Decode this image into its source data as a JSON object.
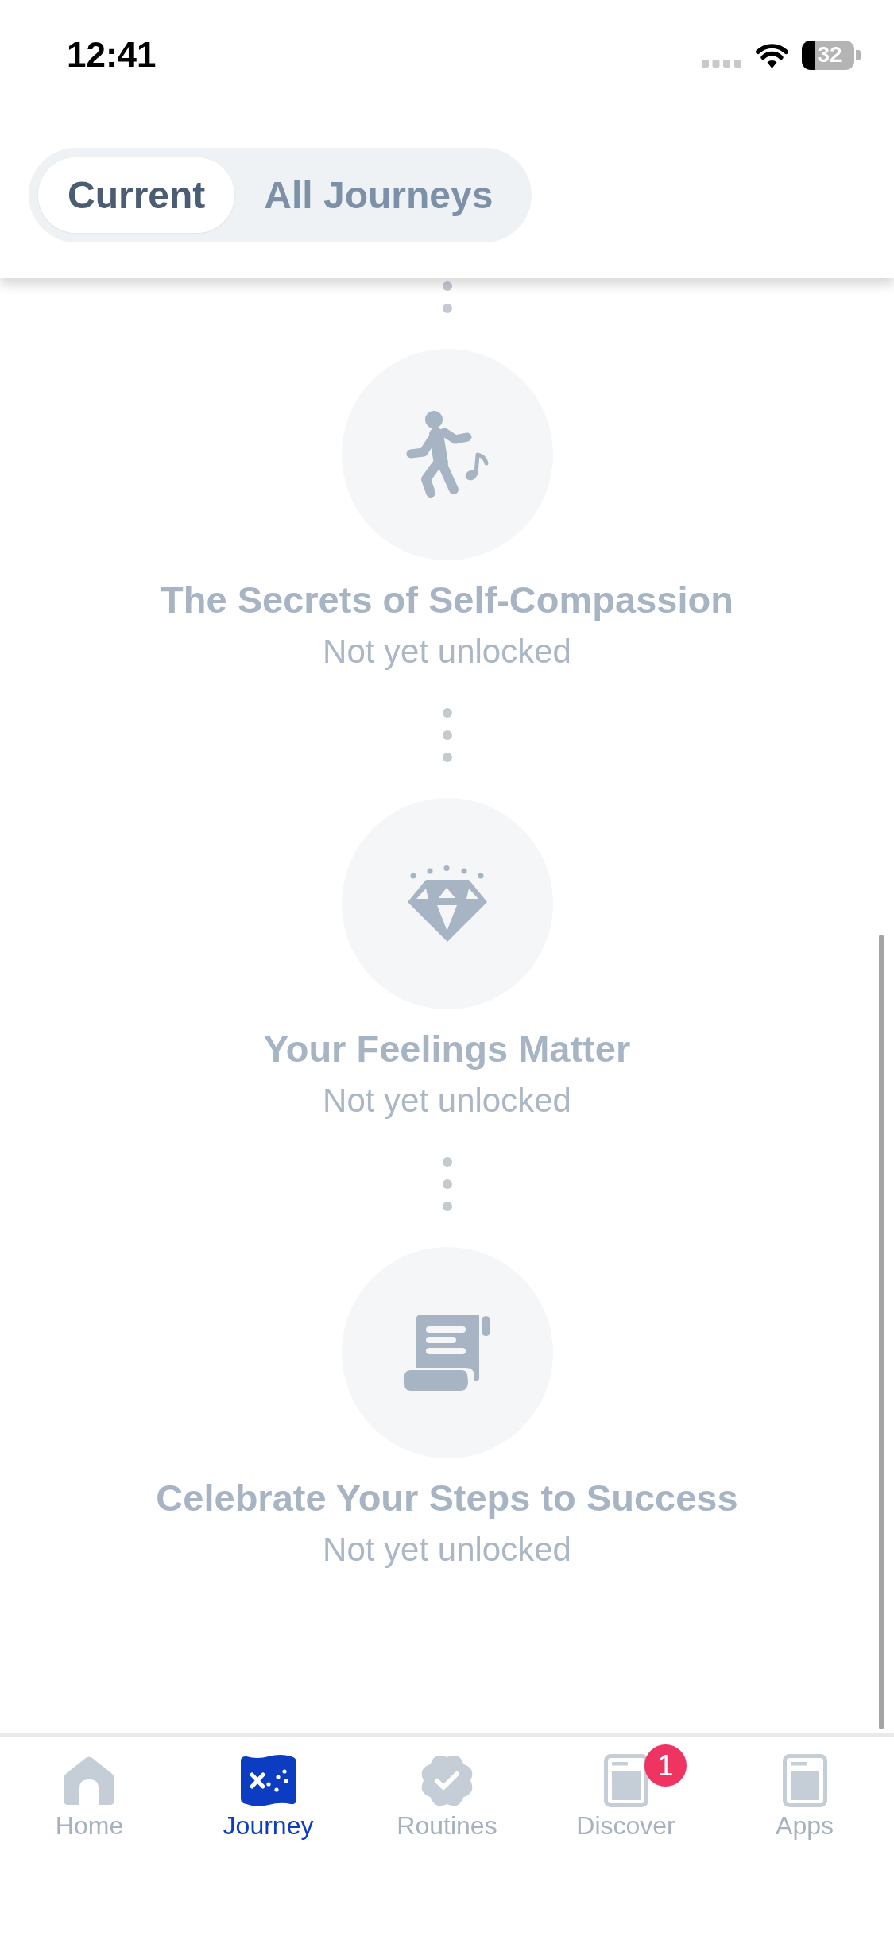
{
  "status_bar": {
    "time": "12:41",
    "battery": "32"
  },
  "segmented_control": [
    {
      "label": "Current",
      "selected": true
    },
    {
      "label": "All Journeys",
      "selected": false
    }
  ],
  "journey_steps": [
    {
      "title": "The Secrets of Self-Compassion",
      "status": "Not yet unlocked",
      "locked": true
    },
    {
      "title": "Your Feelings Matter",
      "status": "Not yet unlocked",
      "locked": true
    },
    {
      "title": "Celebrate Your Steps to Success",
      "status": "Not yet unlocked",
      "locked": true
    }
  ],
  "tab_bar": [
    {
      "label": "Home",
      "selected": false
    },
    {
      "label": "Journey",
      "selected": true
    },
    {
      "label": "Routines",
      "selected": false
    },
    {
      "label": "Discover",
      "selected": false,
      "badge": "1"
    },
    {
      "label": "Apps",
      "selected": false
    }
  ]
}
